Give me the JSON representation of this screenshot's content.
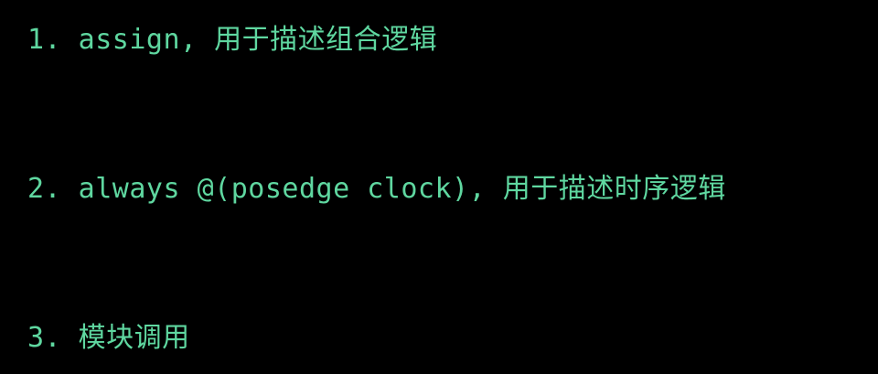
{
  "colors": {
    "background": "#000000",
    "text": "#5fd7a0"
  },
  "lines": [
    {
      "text": "1. assign, 用于描述组合逻辑"
    },
    {
      "text": "2. always @(posedge clock), 用于描述时序逻辑"
    },
    {
      "text": "3. 模块调用"
    }
  ]
}
